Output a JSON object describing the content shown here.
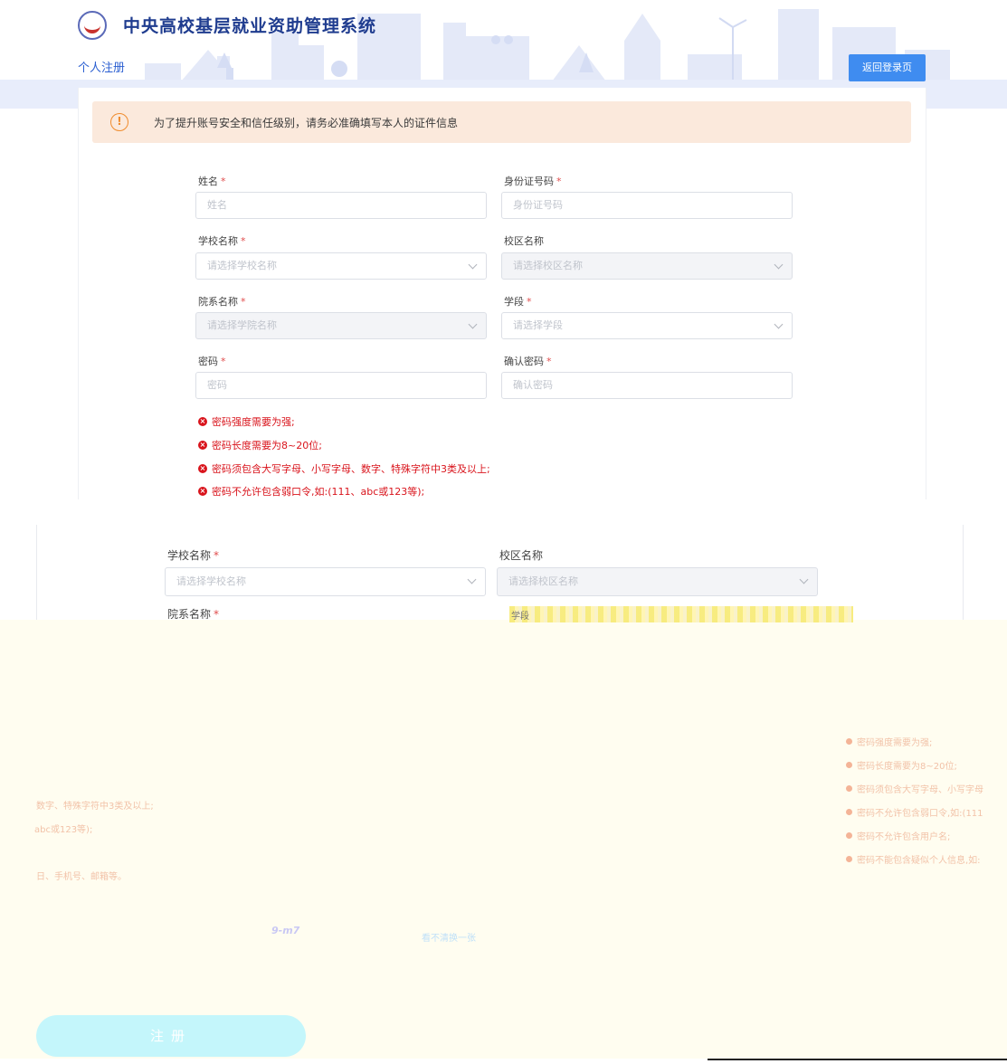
{
  "header": {
    "system_title": "中央高校基层就业资助管理系统",
    "page_label": "个人注册",
    "back_login_label": "返回登录页"
  },
  "alert": {
    "icon_glyph": "!",
    "text": "为了提升账号安全和信任级别，请务必准确填写本人的证件信息"
  },
  "form": {
    "required_mark": "*",
    "fields": [
      {
        "label": "姓名",
        "required": true,
        "placeholder": "姓名"
      },
      {
        "label": "身份证号码",
        "required": true,
        "placeholder": "身份证号码"
      },
      {
        "label": "学校名称",
        "required": true,
        "placeholder": "请选择学校名称"
      },
      {
        "label": "校区名称",
        "required": false,
        "placeholder": "请选择校区名称"
      },
      {
        "label": "院系名称",
        "required": true,
        "placeholder": "请选择学院名称"
      },
      {
        "label": "学段",
        "required": true,
        "placeholder": "请选择学段"
      },
      {
        "label": "密码",
        "required": true,
        "placeholder": "密码"
      },
      {
        "label": "确认密码",
        "required": true,
        "placeholder": "确认密码"
      }
    ],
    "rules_icon": "×",
    "password_rules": [
      "密码强度需要为强;",
      "密码长度需要为8~20位;",
      "密码须包含大写字母、小写字母、数字、特殊字符中3类及以上;",
      "密码不允许包含弱口令,如:(111、abc或123等);"
    ]
  },
  "fragment2": {
    "school_label": "学校名称",
    "school_placeholder": "请选择学校名称",
    "campus_label": "校区名称",
    "campus_placeholder": "请选择校区名称",
    "dept_label": "院系名称",
    "stage_label": "学段"
  },
  "faint": {
    "rules_right": [
      "密码强度需要为强;",
      "密码长度需要为8~20位;",
      "密码须包含大写字母、小写字母",
      "密码不允许包含弱口令,如:(111",
      "密码不允许包含用户名;",
      "密码不能包含疑似个人信息,如:"
    ],
    "left_1": "数字、特殊字符中3类及以上;",
    "left_2": "abc或123等);",
    "left_3": "日、手机号、邮箱等。",
    "captcha": "9-m7",
    "captcha_link": "看不清换一张"
  },
  "register_button": "注册",
  "colors": {
    "brand_blue": "#1f3c8f",
    "button_blue": "#3f8cf0",
    "error_red": "#d9141c",
    "alert_bg": "#fbe9dc"
  }
}
